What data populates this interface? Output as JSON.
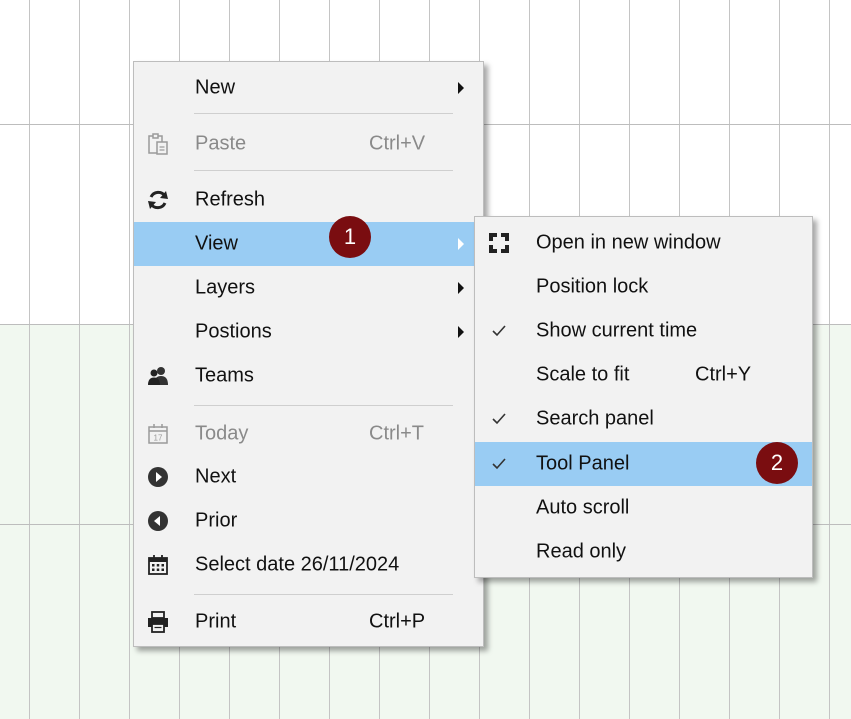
{
  "context_menu": {
    "items": [
      {
        "label": "New",
        "shortcut": "",
        "disabled": false,
        "icon": "",
        "submenu": true
      },
      {
        "label": "Paste",
        "shortcut": "Ctrl+V",
        "disabled": true,
        "icon": "paste-icon",
        "submenu": false
      },
      {
        "label": "Refresh",
        "shortcut": "",
        "disabled": false,
        "icon": "refresh-icon",
        "submenu": false
      },
      {
        "label": "View",
        "shortcut": "",
        "disabled": false,
        "icon": "",
        "submenu": true,
        "highlighted": true
      },
      {
        "label": "Layers",
        "shortcut": "",
        "disabled": false,
        "icon": "",
        "submenu": true
      },
      {
        "label": "Postions",
        "shortcut": "",
        "disabled": false,
        "icon": "",
        "submenu": true
      },
      {
        "label": "Teams",
        "shortcut": "",
        "disabled": false,
        "icon": "teams-icon",
        "submenu": false
      },
      {
        "label": "Today",
        "shortcut": "Ctrl+T",
        "disabled": true,
        "icon": "calendar-today-icon",
        "submenu": false
      },
      {
        "label": "Next",
        "shortcut": "",
        "disabled": false,
        "icon": "next-icon",
        "submenu": false
      },
      {
        "label": "Prior",
        "shortcut": "",
        "disabled": false,
        "icon": "prior-icon",
        "submenu": false
      },
      {
        "label": "Select date 26/11/2024",
        "shortcut": "",
        "disabled": false,
        "icon": "calendar-icon",
        "submenu": false
      },
      {
        "label": "Print",
        "shortcut": "Ctrl+P",
        "disabled": false,
        "icon": "print-icon",
        "submenu": false
      }
    ]
  },
  "view_submenu": {
    "items": [
      {
        "label": "Open in new window",
        "shortcut": "",
        "checked": false,
        "icon": "open-window-icon"
      },
      {
        "label": "Position lock",
        "shortcut": "",
        "checked": false,
        "icon": ""
      },
      {
        "label": "Show current time",
        "shortcut": "",
        "checked": true,
        "icon": ""
      },
      {
        "label": "Scale to fit",
        "shortcut": "Ctrl+Y",
        "checked": false,
        "icon": ""
      },
      {
        "label": "Search panel",
        "shortcut": "",
        "checked": true,
        "icon": ""
      },
      {
        "label": "Tool Panel",
        "shortcut": "",
        "checked": true,
        "icon": "",
        "highlighted": true
      },
      {
        "label": "Auto scroll",
        "shortcut": "",
        "checked": false,
        "icon": ""
      },
      {
        "label": "Read only",
        "shortcut": "",
        "checked": false,
        "icon": ""
      }
    ]
  },
  "badges": [
    "1",
    "2"
  ],
  "colors": {
    "highlight": "#99ccf3",
    "badge": "#7a0d10",
    "menu_background": "#f2f2f2",
    "grid_line": "#bdbdbd",
    "lower_background": "#f1f8f0"
  }
}
